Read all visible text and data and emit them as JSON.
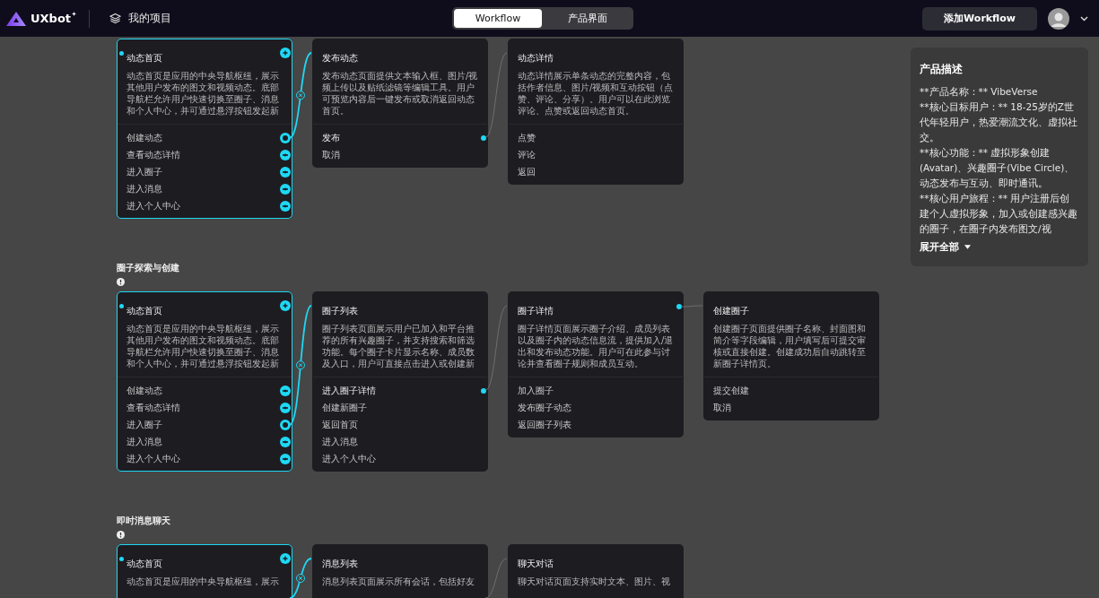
{
  "header": {
    "logo": "UXbot",
    "project_link": "我的项目",
    "tabs": [
      {
        "label": "Workflow",
        "selected": true
      },
      {
        "label": "产品界面",
        "selected": false
      }
    ],
    "add_button": "添加Workflow"
  },
  "flows": [
    {
      "nodes": [
        {
          "title": "动态首页",
          "description": "动态首页是应用的中央导航枢纽，展示其他用户发布的图文和视频动态。底部导航栏允许用户快速切换至圈子、消息和个人中心，并可通过悬浮按钮发起新",
          "actions": [
            {
              "label": "创建动态",
              "linked": true
            },
            {
              "label": "查看动态详情",
              "linked": false
            },
            {
              "label": "进入圈子",
              "linked": false
            },
            {
              "label": "进入消息",
              "linked": false
            },
            {
              "label": "进入个人中心",
              "linked": false
            }
          ],
          "selected": true,
          "link": {
            "kind": "action",
            "highlighted": true
          }
        },
        {
          "title": "发布动态",
          "description": "发布动态页面提供文本输入框、图片/视频上传以及贴纸滤镜等编辑工具。用户可预览内容后一键发布或取消返回动态首页。",
          "actions": [
            {
              "label": "发布",
              "linked": true
            },
            {
              "label": "取消",
              "linked": false
            }
          ],
          "selected": false,
          "link": {
            "kind": "action",
            "highlighted": false
          }
        },
        {
          "title": "动态详情",
          "description": "动态详情展示单条动态的完整内容，包括作者信息、图片/视频和互动按钮（点赞、评论、分享）。用户可以在此浏览评论、点赞或返回动态首页。",
          "actions": [
            {
              "label": "点赞",
              "linked": false
            },
            {
              "label": "评论",
              "linked": false
            },
            {
              "label": "返回",
              "linked": false
            }
          ],
          "selected": false
        }
      ]
    },
    {
      "title": "圈子探索与创建",
      "nodes": [
        {
          "title": "动态首页",
          "description": "动态首页是应用的中央导航枢纽，展示其他用户发布的图文和视频动态。底部导航栏允许用户快速切换至圈子、消息和个人中心，并可通过悬浮按钮发起新",
          "actions": [
            {
              "label": "创建动态",
              "linked": false
            },
            {
              "label": "查看动态详情",
              "linked": false
            },
            {
              "label": "进入圈子",
              "linked": true
            },
            {
              "label": "进入消息",
              "linked": false
            },
            {
              "label": "进入个人中心",
              "linked": false
            }
          ],
          "selected": true,
          "link": {
            "kind": "action",
            "highlighted": true
          }
        },
        {
          "title": "圈子列表",
          "description": "圈子列表页面展示用户已加入和平台推荐的所有兴趣圈子，并支持搜索和筛选功能。每个圈子卡片显示名称、成员数及入口，用户可直接点击进入或创建新",
          "actions": [
            {
              "label": "进入圈子详情",
              "linked": true
            },
            {
              "label": "创建新圈子",
              "linked": false
            },
            {
              "label": "返回首页",
              "linked": false
            },
            {
              "label": "进入消息",
              "linked": false
            },
            {
              "label": "进入个人中心",
              "linked": false
            }
          ],
          "selected": false,
          "link": {
            "kind": "action",
            "highlighted": false
          }
        },
        {
          "title": "圈子详情",
          "description": "圈子详情页面展示圈子介绍、成员列表以及圈子内的动态信息流，提供加入/退出和发布动态功能。用户可在此参与讨论并查看圈子规则和成员互动。",
          "actions": [
            {
              "label": "加入圈子",
              "linked": false
            },
            {
              "label": "发布圈子动态",
              "linked": false
            },
            {
              "label": "返回圈子列表",
              "linked": false
            }
          ],
          "selected": false,
          "link": {
            "kind": "header",
            "highlighted": false
          }
        },
        {
          "title": "创建圈子",
          "description": "创建圈子页面提供圈子名称、封面图和简介等字段编辑，用户填写后可提交审核或直接创建。创建成功后自动跳转至新圈子详情页。",
          "actions": [
            {
              "label": "提交创建",
              "linked": false
            },
            {
              "label": "取消",
              "linked": false
            }
          ],
          "selected": false
        }
      ]
    },
    {
      "title": "即时消息聊天",
      "nodes": [
        {
          "title": "动态首页",
          "description": "动态首页是应用的中央导航枢纽，展示",
          "selected": true,
          "link": {
            "kind": "below",
            "highlighted": true
          }
        },
        {
          "title": "消息列表",
          "description": "消息列表页面展示所有会话，包括好友",
          "selected": false,
          "link": {
            "kind": "below",
            "highlighted": false
          }
        },
        {
          "title": "聊天对话",
          "description": "聊天对话页面支持实时文本、图片、视",
          "selected": false
        }
      ]
    }
  ],
  "product_panel": {
    "title": "产品描述",
    "lines": [
      "**产品名称：** VibeVerse",
      "**核心目标用户：** 18-25岁的Z世代年轻用户，热爱潮流文化、虚拟社交。",
      "**核心功能：** 虚拟形象创建(Avatar)、兴趣圈子(Vibe Circle)、动态发布与互动、即时通讯。",
      "**核心用户旅程：** 用户注册后创建个人虚拟形象，加入或创建感兴趣的圈子，在圈子内发布图文/视"
    ],
    "expand": "展开全部"
  }
}
